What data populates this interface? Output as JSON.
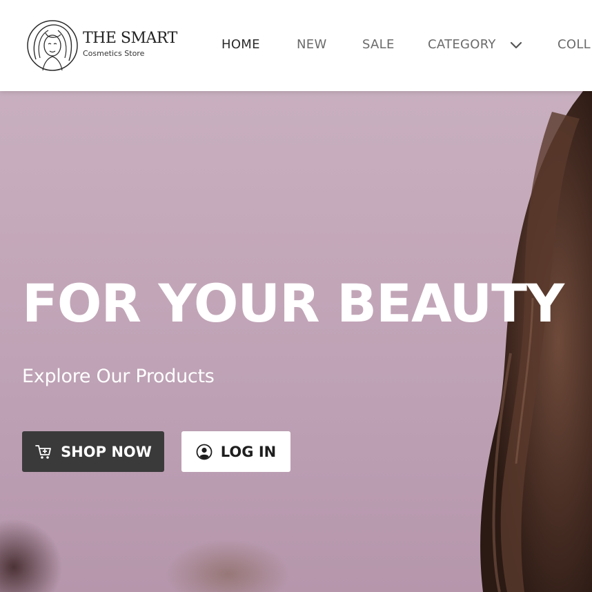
{
  "brand": {
    "name": "THE SMART",
    "tagline": "Cosmetics Store",
    "logo_icon": "woman-face-logo-icon"
  },
  "nav": {
    "items": [
      {
        "label": "HOME",
        "active": true
      },
      {
        "label": "NEW",
        "active": false
      },
      {
        "label": "SALE",
        "active": false
      },
      {
        "label": "CATEGORY",
        "active": false,
        "icon": "chevron-down-icon"
      },
      {
        "label": "COLL",
        "active": false
      }
    ]
  },
  "hero": {
    "title": "FOR YOUR BEAUTY",
    "subtitle": "Explore Our Products",
    "primary_button": {
      "label": "SHOP NOW",
      "icon": "cart-icon"
    },
    "secondary_button": {
      "label": "LOG IN",
      "icon": "user-circle-icon"
    }
  },
  "colors": {
    "hero_background": "#c2a6b8",
    "primary_button": "#3a3a3a",
    "secondary_button": "#ffffff",
    "nav_active": "#2b2b2b",
    "nav_inactive": "#6a6a6a",
    "hero_text": "#ffffff"
  }
}
